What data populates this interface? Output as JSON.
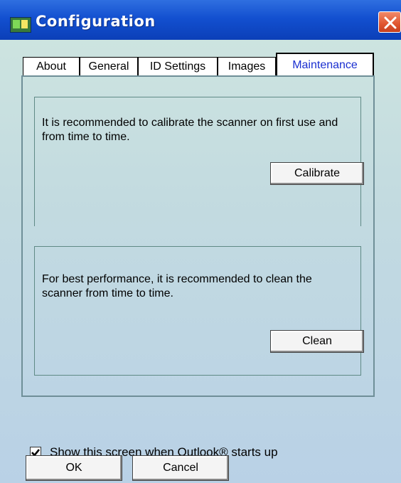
{
  "window": {
    "title": "Configuration"
  },
  "tabs": [
    {
      "label": "About"
    },
    {
      "label": "General"
    },
    {
      "label": "ID Settings"
    },
    {
      "label": "Images"
    },
    {
      "label": "Maintenance"
    }
  ],
  "calibrate": {
    "text": "It is recommended to calibrate the scanner on first use and from time to time.",
    "button_label": "Calibrate"
  },
  "clean": {
    "text": "For best performance, it is recommended to clean the scanner from time to time.",
    "button_label": "Clean"
  },
  "startup_checkbox": {
    "label": "Show this screen when Outlook® starts up",
    "checked": true
  },
  "buttons": {
    "ok": "OK",
    "cancel": "Cancel"
  },
  "icons": {
    "app": "scanner-app-icon",
    "close": "close-icon",
    "check": "checkmark-icon"
  }
}
